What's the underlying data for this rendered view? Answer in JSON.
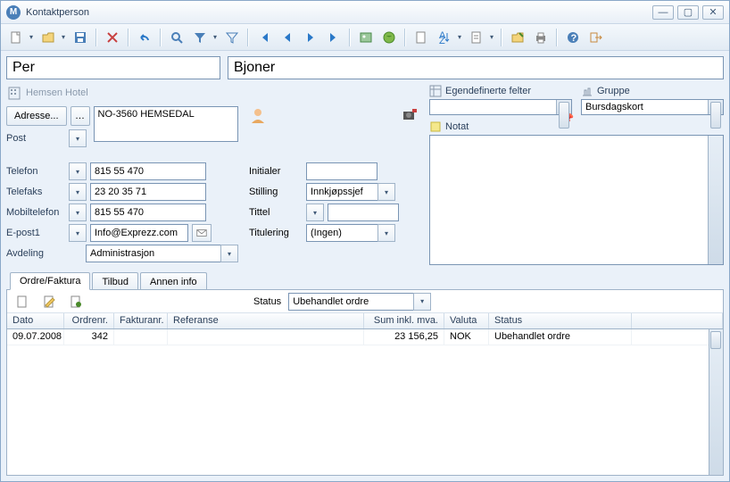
{
  "window": {
    "title": "Kontaktperson"
  },
  "name": {
    "first": "Per",
    "last": "Bjoner"
  },
  "company": "Hemsen Hotel",
  "address": {
    "button": "Adresse...",
    "text": "NO-3560 HEMSEDAL",
    "post_label": "Post"
  },
  "fields": {
    "telefon": {
      "label": "Telefon",
      "value": "815 55 470"
    },
    "telefaks": {
      "label": "Telefaks",
      "value": "23 20 35 71"
    },
    "mobil": {
      "label": "Mobiltelefon",
      "value": "815 55 470"
    },
    "epost": {
      "label": "E-post1",
      "value": "Info@Exprezz.com"
    },
    "avdeling": {
      "label": "Avdeling",
      "value": "Administrasjon"
    }
  },
  "mid": {
    "initialer": {
      "label": "Initialer",
      "value": ""
    },
    "stilling": {
      "label": "Stilling",
      "value": "Innkjøpssjef"
    },
    "tittel": {
      "label": "Tittel",
      "value": ""
    },
    "titulering": {
      "label": "Titulering",
      "value": "(Ingen)"
    }
  },
  "panels": {
    "custom": "Egendefinerte felter",
    "group": "Gruppe",
    "group_item": "Bursdagskort",
    "notat": "Notat"
  },
  "tabs": {
    "t1": "Ordre/Faktura",
    "t2": "Tilbud",
    "t3": "Annen info"
  },
  "status": {
    "label": "Status",
    "value": "Ubehandlet ordre"
  },
  "table": {
    "headers": {
      "dato": "Dato",
      "ordre": "Ordrenr.",
      "faktura": "Fakturanr.",
      "ref": "Referanse",
      "sum": "Sum inkl. mva.",
      "valuta": "Valuta",
      "status": "Status"
    },
    "row": {
      "dato": "09.07.2008",
      "ordre": "342",
      "faktura": "",
      "ref": "",
      "sum": "23 156,25",
      "valuta": "NOK",
      "status": "Ubehandlet ordre"
    }
  }
}
